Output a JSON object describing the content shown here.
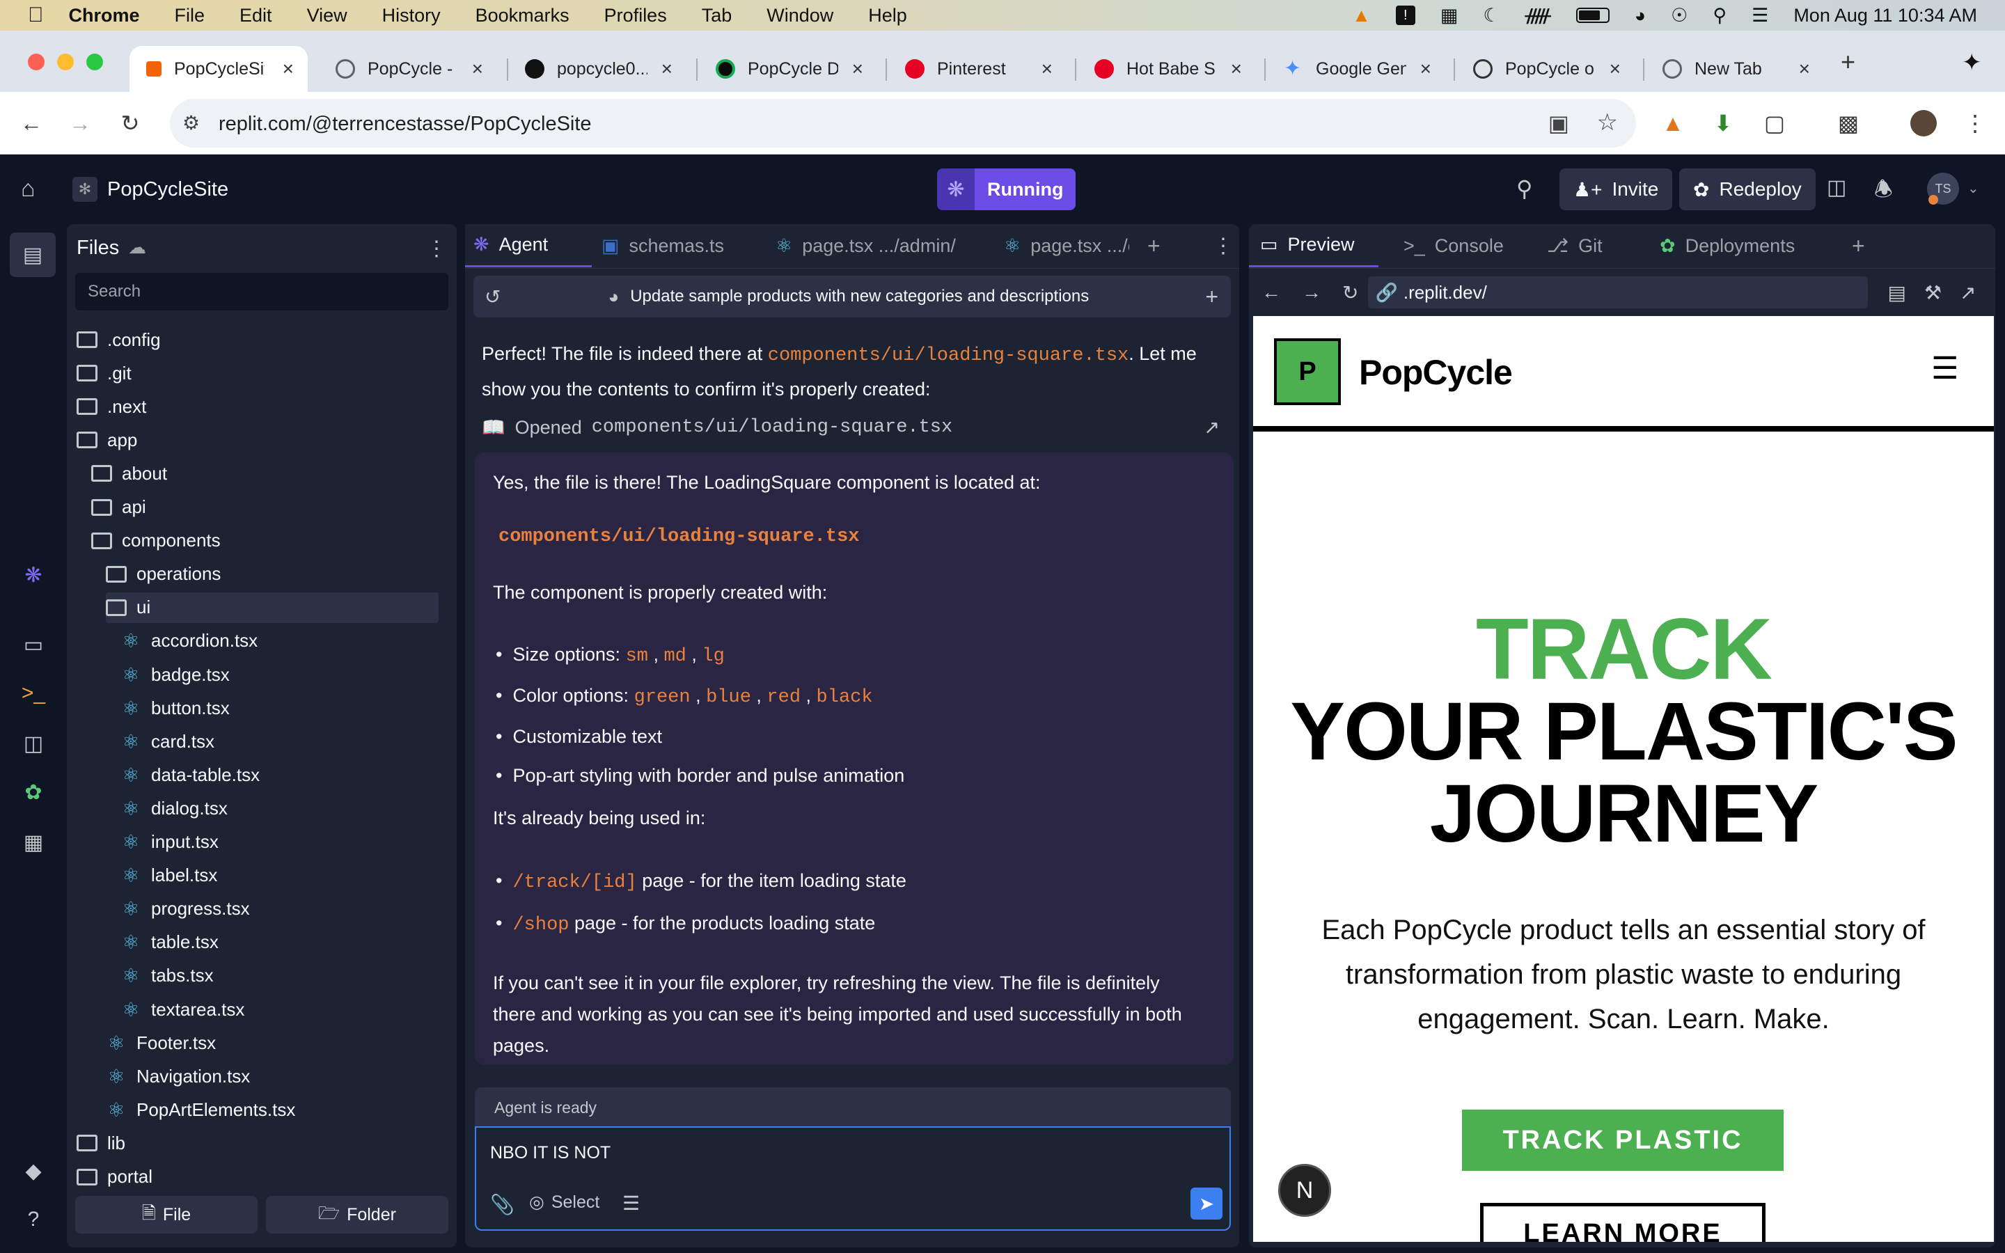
{
  "menubar": {
    "app": "Chrome",
    "items": [
      "File",
      "Edit",
      "View",
      "History",
      "Bookmarks",
      "Profiles",
      "Tab",
      "Window",
      "Help"
    ],
    "clock": "Mon Aug 11  10:34 AM"
  },
  "tabs": [
    {
      "title": "PopCycleSite",
      "fav": "#f26207"
    },
    {
      "title": "PopCycle -",
      "fav": "#5f6368"
    },
    {
      "title": "popcycle0...",
      "fav": "#111111"
    },
    {
      "title": "PopCycle D",
      "fav": "#0b0b0b"
    },
    {
      "title": "Pinterest",
      "fav": "#e60023"
    },
    {
      "title": "Hot Babe S",
      "fav": "#e60023"
    },
    {
      "title": "Google Gen",
      "fav": "#4c8df6"
    },
    {
      "title": "PopCycle o",
      "fav": "#333333"
    },
    {
      "title": "New Tab",
      "fav": "#5f6368"
    }
  ],
  "address": {
    "url": "replit.com/@terrencestasse/PopCycleSite"
  },
  "replit": {
    "project": "PopCycleSite",
    "run_label": "Running",
    "invite": "Invite",
    "redeploy": "Redeploy",
    "avatar": "TS"
  },
  "files": {
    "title": "Files",
    "search_placeholder": "Search",
    "new_file": "File",
    "new_folder": "Folder",
    "tree": [
      {
        "name": ".config",
        "type": "folder",
        "depth": 0
      },
      {
        "name": ".git",
        "type": "folder",
        "depth": 0
      },
      {
        "name": ".next",
        "type": "folder",
        "depth": 0
      },
      {
        "name": "app",
        "type": "folder-open",
        "depth": 0
      },
      {
        "name": "about",
        "type": "folder",
        "depth": 1
      },
      {
        "name": "api",
        "type": "folder",
        "depth": 1
      },
      {
        "name": "components",
        "type": "folder-open",
        "depth": 1
      },
      {
        "name": "operations",
        "type": "folder",
        "depth": 2
      },
      {
        "name": "ui",
        "type": "folder-open",
        "depth": 2,
        "selected": true
      },
      {
        "name": "accordion.tsx",
        "type": "react",
        "depth": 3
      },
      {
        "name": "badge.tsx",
        "type": "react",
        "depth": 3
      },
      {
        "name": "button.tsx",
        "type": "react",
        "depth": 3
      },
      {
        "name": "card.tsx",
        "type": "react",
        "depth": 3
      },
      {
        "name": "data-table.tsx",
        "type": "react",
        "depth": 3
      },
      {
        "name": "dialog.tsx",
        "type": "react",
        "depth": 3
      },
      {
        "name": "input.tsx",
        "type": "react",
        "depth": 3
      },
      {
        "name": "label.tsx",
        "type": "react",
        "depth": 3
      },
      {
        "name": "progress.tsx",
        "type": "react",
        "depth": 3
      },
      {
        "name": "table.tsx",
        "type": "react",
        "depth": 3
      },
      {
        "name": "tabs.tsx",
        "type": "react",
        "depth": 3
      },
      {
        "name": "textarea.tsx",
        "type": "react",
        "depth": 3
      },
      {
        "name": "Footer.tsx",
        "type": "react",
        "depth": 2
      },
      {
        "name": "Navigation.tsx",
        "type": "react",
        "depth": 2
      },
      {
        "name": "PopArtElements.tsx",
        "type": "react",
        "depth": 2
      },
      {
        "name": "lib",
        "type": "folder",
        "depth": 0
      },
      {
        "name": "portal",
        "type": "folder",
        "depth": 0
      }
    ]
  },
  "agent_tabs": [
    "Agent",
    "schemas.ts",
    "page.tsx .../admin/",
    "page.tsx .../c"
  ],
  "agent": {
    "thread_title": "Update sample products with new categories and descriptions",
    "intro_a": "Perfect! The file is indeed there at ",
    "intro_code": "components/ui/loading-square.tsx",
    "intro_b": ". Let me",
    "intro_c": "show you the contents to confirm it's properly created:",
    "opened_label": "Opened",
    "opened_file": "components/ui/loading-square.tsx",
    "msg_p1": "Yes, the file is there! The LoadingSquare component is located at:",
    "msg_path": "components/ui/loading-square.tsx",
    "msg_p2": "The component is properly created with:",
    "size_label": "Size options: ",
    "sizes": [
      "sm",
      "md",
      "lg"
    ],
    "color_label": "Color options: ",
    "colors": [
      "green",
      "blue",
      "red",
      "black"
    ],
    "b3": "Customizable text",
    "b4": "Pop-art styling with border and pulse animation",
    "msg_p3": "It's already being used in:",
    "use1_code": "/track/[id]",
    "use1_text": " page - for the item loading state",
    "use2_code": "/shop",
    "use2_text": " page - for the products loading state",
    "msg_p4a": "If you can't see it in your file explorer, try refreshing the view. The file is definitely",
    "msg_p4b": "there and working as you can see it's being imported and used successfully in both",
    "msg_p4c": "pages.",
    "status": "Agent is ready",
    "input_value": "NBO IT IS NOT",
    "select": "Select"
  },
  "preview_tabs": [
    "Preview",
    "Console",
    "Git",
    "Deployments"
  ],
  "preview": {
    "url": ".replit.dev/",
    "logo_letter": "P",
    "brand": "PopCycle",
    "h_green": "TRACK",
    "h_line2": "YOUR PLASTIC'S",
    "h_line3": "JOURNEY",
    "sub1": "Each PopCycle product tells an essential story of",
    "sub2": "transformation from plastic waste to enduring",
    "sub3": "engagement. Scan. Learn. Make.",
    "cta": "TRACK PLASTIC",
    "cta2": "LEARN MORE",
    "next_badge": "N"
  },
  "colors": {
    "accent_purple": "#6b4ce6",
    "site_green": "#4caf50",
    "code_orange": "#e8823c"
  }
}
